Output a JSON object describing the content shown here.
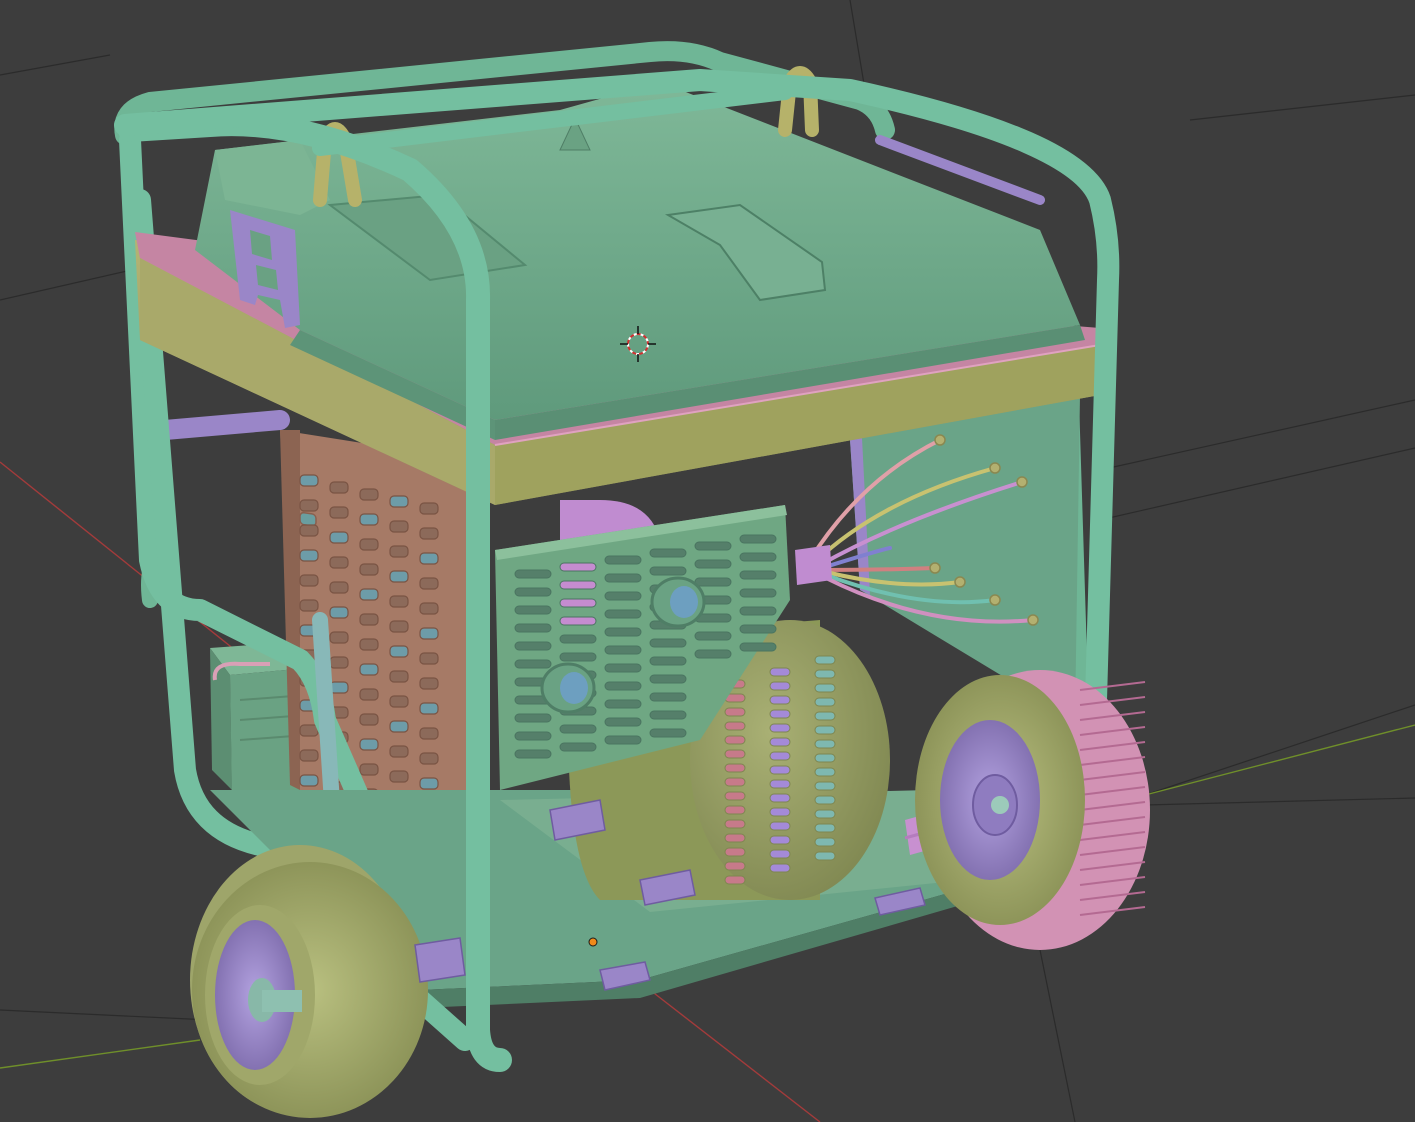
{
  "viewport": {
    "background": "#3d3d3d",
    "grid_color": "#2a2a2a",
    "x_axis_color": "#b03a3a",
    "y_axis_color": "#7a9a2a"
  },
  "object": {
    "frame_color": "#74bfa0",
    "body_color": "#6ea587",
    "tank_color": "#6fa88a",
    "base_color": "#6aa488",
    "rail_color": "#a8a866",
    "gasket_color": "#c080a0",
    "accent_purple": "#9a86c8",
    "muffler_color": "#a87a68",
    "wheel_color": "#a5ae70",
    "tire_color": "#d090b0"
  },
  "icons": {
    "cursor": "3d-cursor-icon",
    "origin": "object-origin-icon"
  }
}
